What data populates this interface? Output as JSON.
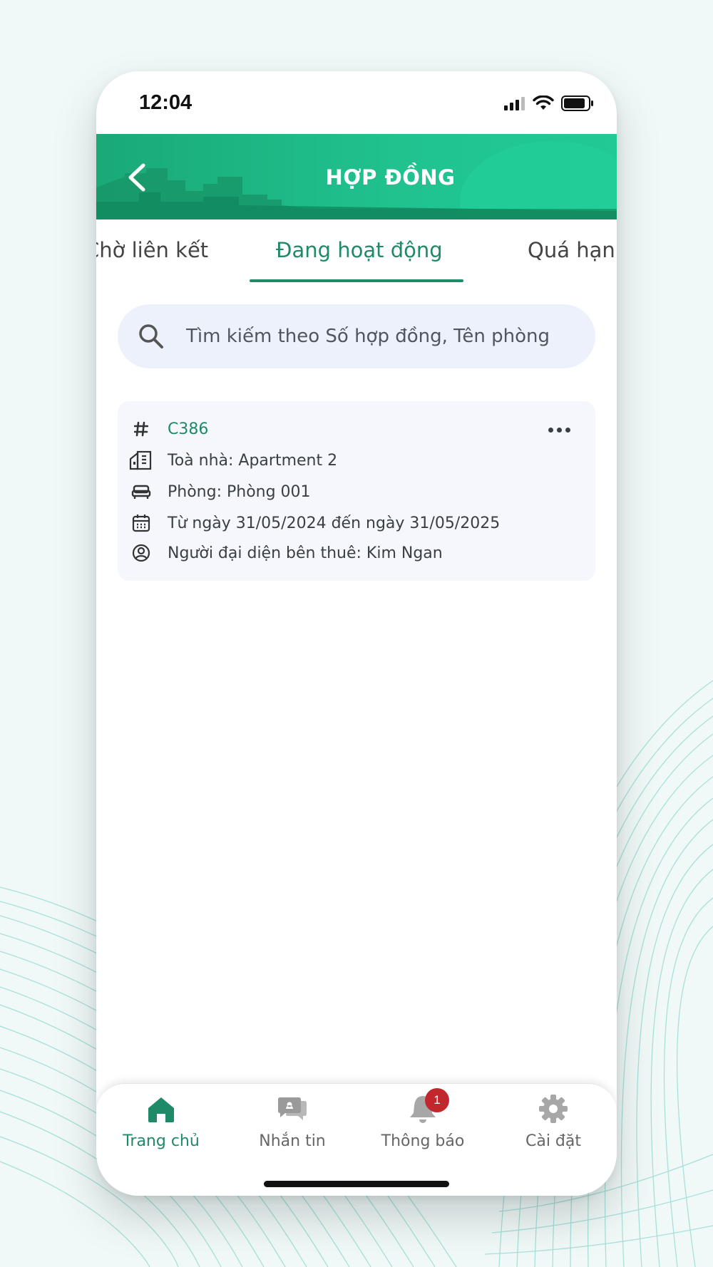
{
  "status_bar": {
    "time": "12:04"
  },
  "header": {
    "title": "HỢP ĐỒNG"
  },
  "tabs": [
    {
      "label": "Chờ liên kết",
      "active": false
    },
    {
      "label": "Đang hoạt động",
      "active": true
    },
    {
      "label": "Quá hạn",
      "active": false
    }
  ],
  "search": {
    "placeholder": "Tìm kiếm theo Số hợp đồng, Tên phòng"
  },
  "contract": {
    "code": "C386",
    "building": "Toà nhà: Apartment 2",
    "room": "Phòng: Phòng 001",
    "period": "Từ ngày 31/05/2024 đến ngày 31/05/2025",
    "representative": "Người đại diện bên thuê: Kim Ngan"
  },
  "bottom_nav": [
    {
      "label": "Trang chủ",
      "icon": "home-icon",
      "active": true
    },
    {
      "label": "Nhắn tin",
      "icon": "chat-icon",
      "active": false
    },
    {
      "label": "Thông báo",
      "icon": "bell-icon",
      "active": false,
      "badge": "1"
    },
    {
      "label": "Cài đặt",
      "icon": "gear-icon",
      "active": false
    }
  ],
  "colors": {
    "primary": "#1f8a67",
    "header": "#20c38f",
    "badge": "#c1272d"
  }
}
